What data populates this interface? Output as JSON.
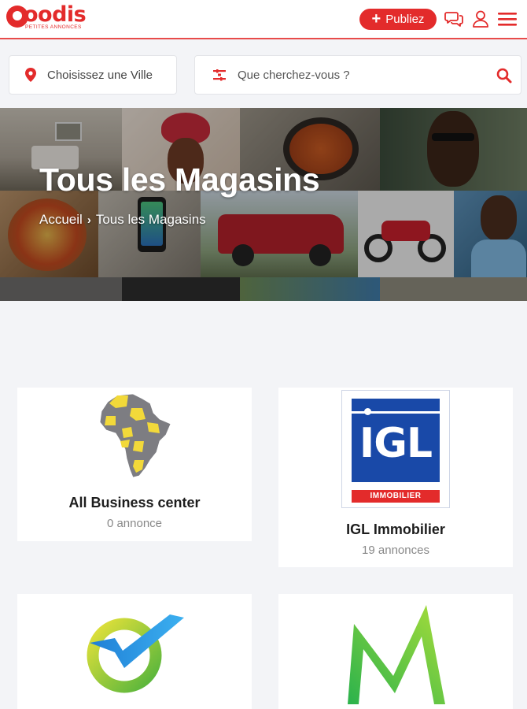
{
  "header": {
    "logo_text": "oodis",
    "logo_tagline": "PETITES ANNONCES",
    "publish_label": "Publiez"
  },
  "search": {
    "city_label": "Choisissez une Ville",
    "query_placeholder": "Que cherchez-vous ?"
  },
  "banner": {
    "title": "Tous les Magasins",
    "breadcrumb": [
      "Accueil",
      "Tous les Magasins"
    ]
  },
  "stores": [
    {
      "name": "All Business center",
      "count": "0 annonce",
      "logo": "africa-map-icon"
    },
    {
      "name": "IGL Immobilier",
      "count": "19 annonces",
      "logo": "igl-logo",
      "logo_text": "IGL",
      "logo_subtext": "IMMOBILIER"
    },
    {
      "name": "",
      "count": "",
      "logo": "checkmark-circle-logo"
    },
    {
      "name": "",
      "count": "",
      "logo": "green-m-logo"
    }
  ],
  "colors": {
    "brand": "#e32b2b",
    "background": "#f3f4f7",
    "igl_blue": "#1949a8"
  }
}
